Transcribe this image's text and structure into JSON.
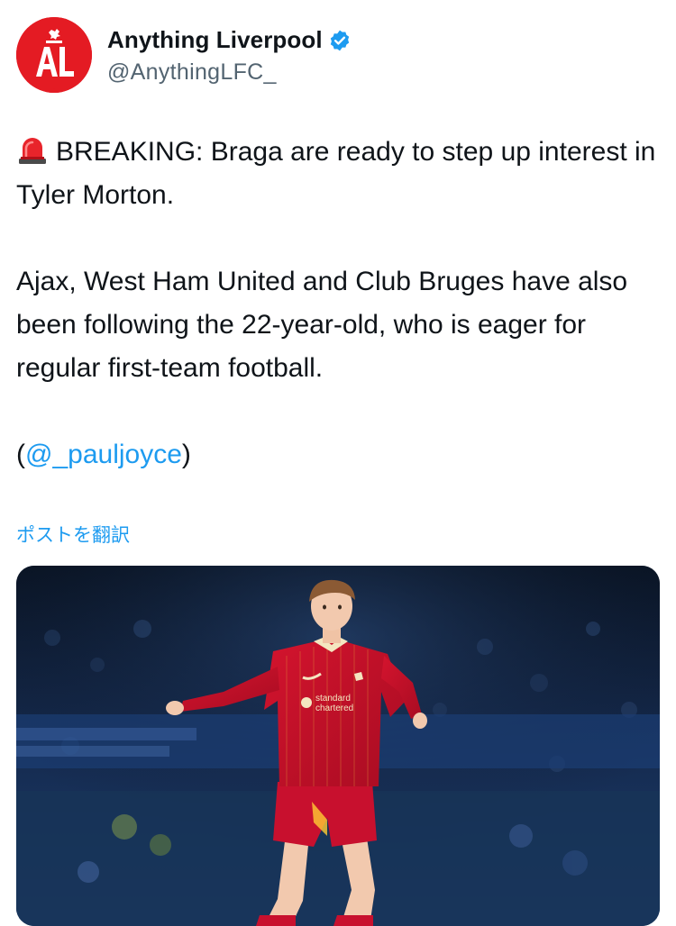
{
  "header": {
    "display_name": "Anything Liverpool",
    "handle": "@AnythingLFC_",
    "avatar_text": "AL",
    "verified": true
  },
  "tweet": {
    "line1_emoji": "siren-icon",
    "line1_text": "BREAKING: Braga are ready to step up interest in Tyler Morton.",
    "para2": "Ajax, West Ham United and Club Bruges have also been following the 22-year-old, who is eager for regular first-team football.",
    "source_open": "(",
    "source_mention": "@_pauljoyce",
    "source_close": ")"
  },
  "translate_label": "ポストを翻訳",
  "media": {
    "subject": "Liverpool player in red kit dribbling a ball at night stadium",
    "sponsor_text": "standard chartered"
  },
  "colors": {
    "link": "#1d9bf0",
    "text": "#0f1419",
    "secondary": "#536471",
    "avatar_bg": "#e41b23",
    "kit_red": "#c8102e"
  }
}
